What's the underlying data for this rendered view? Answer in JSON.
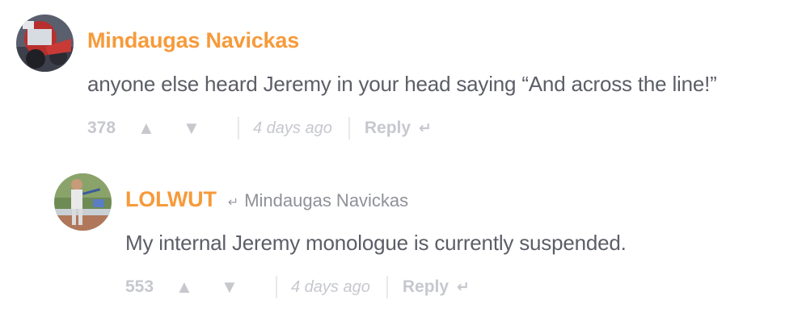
{
  "comments": [
    {
      "author": "Mindaugas Navickas",
      "text": "anyone else heard Jeremy in your head saying “And across the line!”",
      "score": "378",
      "timestamp": "4 days ago",
      "reply_label": "Reply",
      "icons": {
        "upvote": "triangle-up-icon",
        "downvote": "triangle-down-icon",
        "reply": "reply-arrow-icon"
      }
    },
    {
      "author": "LOLWUT",
      "in_reply_to": "Mindaugas Navickas",
      "text": "My internal Jeremy monologue is currently suspended.",
      "score": "553",
      "timestamp": "4 days ago",
      "reply_label": "Reply",
      "icons": {
        "upvote": "triangle-up-icon",
        "downvote": "triangle-down-icon",
        "reply": "reply-arrow-icon",
        "in_reply_to": "reply-arrow-icon"
      }
    }
  ],
  "colors": {
    "author": "#f79a3a",
    "body_text": "#5c5e67",
    "muted": "#c6c8ce",
    "reply_to": "#8f9198"
  }
}
